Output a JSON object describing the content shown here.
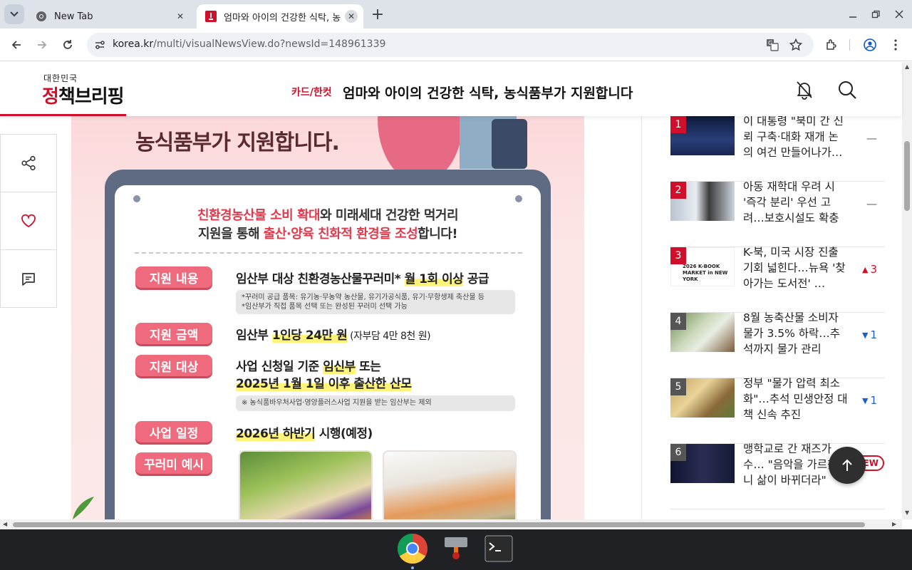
{
  "browser": {
    "tabs": [
      {
        "title": "New Tab",
        "active": false
      },
      {
        "title": "엄마와 아이의 건강한 식탁, 농",
        "active": true
      }
    ],
    "url": {
      "domain": "korea.kr",
      "path": "/multi/visualNewsView.do?newsId=148961339"
    }
  },
  "site": {
    "logo_small": "대한민국",
    "logo_main_red": "정",
    "logo_main_rest": "책브리핑",
    "category": "카드/한컷",
    "title": "엄마와 아이의 건강한 식탁, 농식품부가 지원합니다"
  },
  "card": {
    "headline": "농식품부가 지원합니다.",
    "intro_line1_red": "친환경농산물 소비 확대",
    "intro_line1_rest": "와 미래세대 건강한 먹거리",
    "intro_line2_a": "지원을 통해 ",
    "intro_line2_red": "출산·양육 친화적 환경을 조성",
    "intro_line2_b": "합니다!",
    "rows": [
      {
        "label": "지원 내용",
        "text": "임산부 대상 친환경농산물꾸러미* ",
        "highlight": "월 1회 이상",
        "tail": " 공급",
        "note1": "*꾸러미 공급 품목: 유기농·무농약 농산물, 유기가공식품, 유기·무항생제 축산물 등",
        "note2": "*임산부가 직접 품목 선택 또는 완성된 꾸러미 선택 가능"
      },
      {
        "label": "지원 금액",
        "text": "임산부 ",
        "highlight": "1인당 24만 원",
        "tail": " (자부담 4만 8천 원)"
      },
      {
        "label": "지원 대상",
        "text": "사업 신청일 기준 ",
        "highlight": "임신부",
        "tail": " 또는",
        "line2": "2025년 1월 1일 이후 출산한 산모",
        "note1": "※ 농식품바우처사업·영양플러스사업 지원을 받는 임산부는 제외"
      },
      {
        "label": "사업 일정",
        "text": "",
        "highlight": "2026년 하반기",
        "tail": " 시행(예정)"
      },
      {
        "label": "꾸러미 예시"
      }
    ]
  },
  "ranking": [
    {
      "rank": "1",
      "title": "이 대통령 \"북미 간 신뢰 구축·대화 재개 논의 여건 만들어나가…",
      "change": "flat",
      "change_value": ""
    },
    {
      "rank": "2",
      "title": "아동 재학대 우려 시 '즉각 분리' 우선 고려…보호시설도 확충",
      "change": "flat",
      "change_value": ""
    },
    {
      "rank": "3",
      "title": "K-북, 미국 시장 진출 기회 넓힌다…뉴욕 '찾아가는 도서전' …",
      "change": "up",
      "change_value": "3",
      "thumb_text": "2026 K-BOOK MARKET in NEW YORK"
    },
    {
      "rank": "4",
      "title": "8월 농축산물 소비자물가 3.5% 하락…추석까지 물가 관리",
      "change": "down",
      "change_value": "1"
    },
    {
      "rank": "5",
      "title": "정부 \"물가 압력 최소화\"…추석 민생안정 대책 신속 추진",
      "change": "down",
      "change_value": "1"
    },
    {
      "rank": "6",
      "title": "맹학교로 간 재즈가수… \"음악을 가르쳤더니 삶이 바뀌더라\"",
      "change": "new",
      "change_value": "NEW"
    }
  ],
  "colors": {
    "brand_red": "#d0102b",
    "pill_pink": "#ef6a7c",
    "tablet_frame": "#5f6a83"
  }
}
